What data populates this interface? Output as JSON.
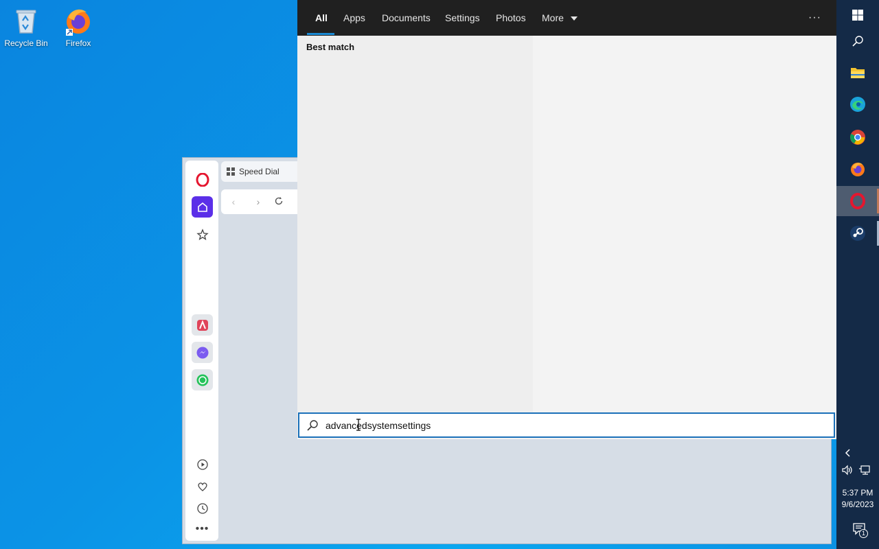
{
  "desktop": {
    "icons": [
      {
        "label": "Recycle Bin",
        "icon": "recycle-bin-icon"
      },
      {
        "label": "Firefox",
        "icon": "firefox-icon"
      }
    ]
  },
  "opera": {
    "tab_label": "Speed Dial",
    "sidebar": [
      "opera-logo-icon",
      "home-icon",
      "star-icon",
      "aria-icon",
      "messenger-icon",
      "whatsapp-icon",
      "player-icon",
      "heart-icon",
      "history-icon",
      "more-icon"
    ],
    "accent": "#5b2fe8"
  },
  "search": {
    "tabs": [
      "All",
      "Apps",
      "Documents",
      "Settings",
      "Photos",
      "More"
    ],
    "active_tab": "All",
    "more_menu_label": "···",
    "best_match_label": "Best match",
    "query": "advancedsystemsettings",
    "accent": "#1a6fb8"
  },
  "taskbar": {
    "apps": [
      "windows-start-icon",
      "search-icon",
      "file-explorer-icon",
      "edge-icon",
      "chrome-icon",
      "firefox-icon",
      "opera-icon",
      "steam-icon"
    ],
    "time": "5:37 PM",
    "date": "9/6/2023",
    "notification_count": "1"
  }
}
